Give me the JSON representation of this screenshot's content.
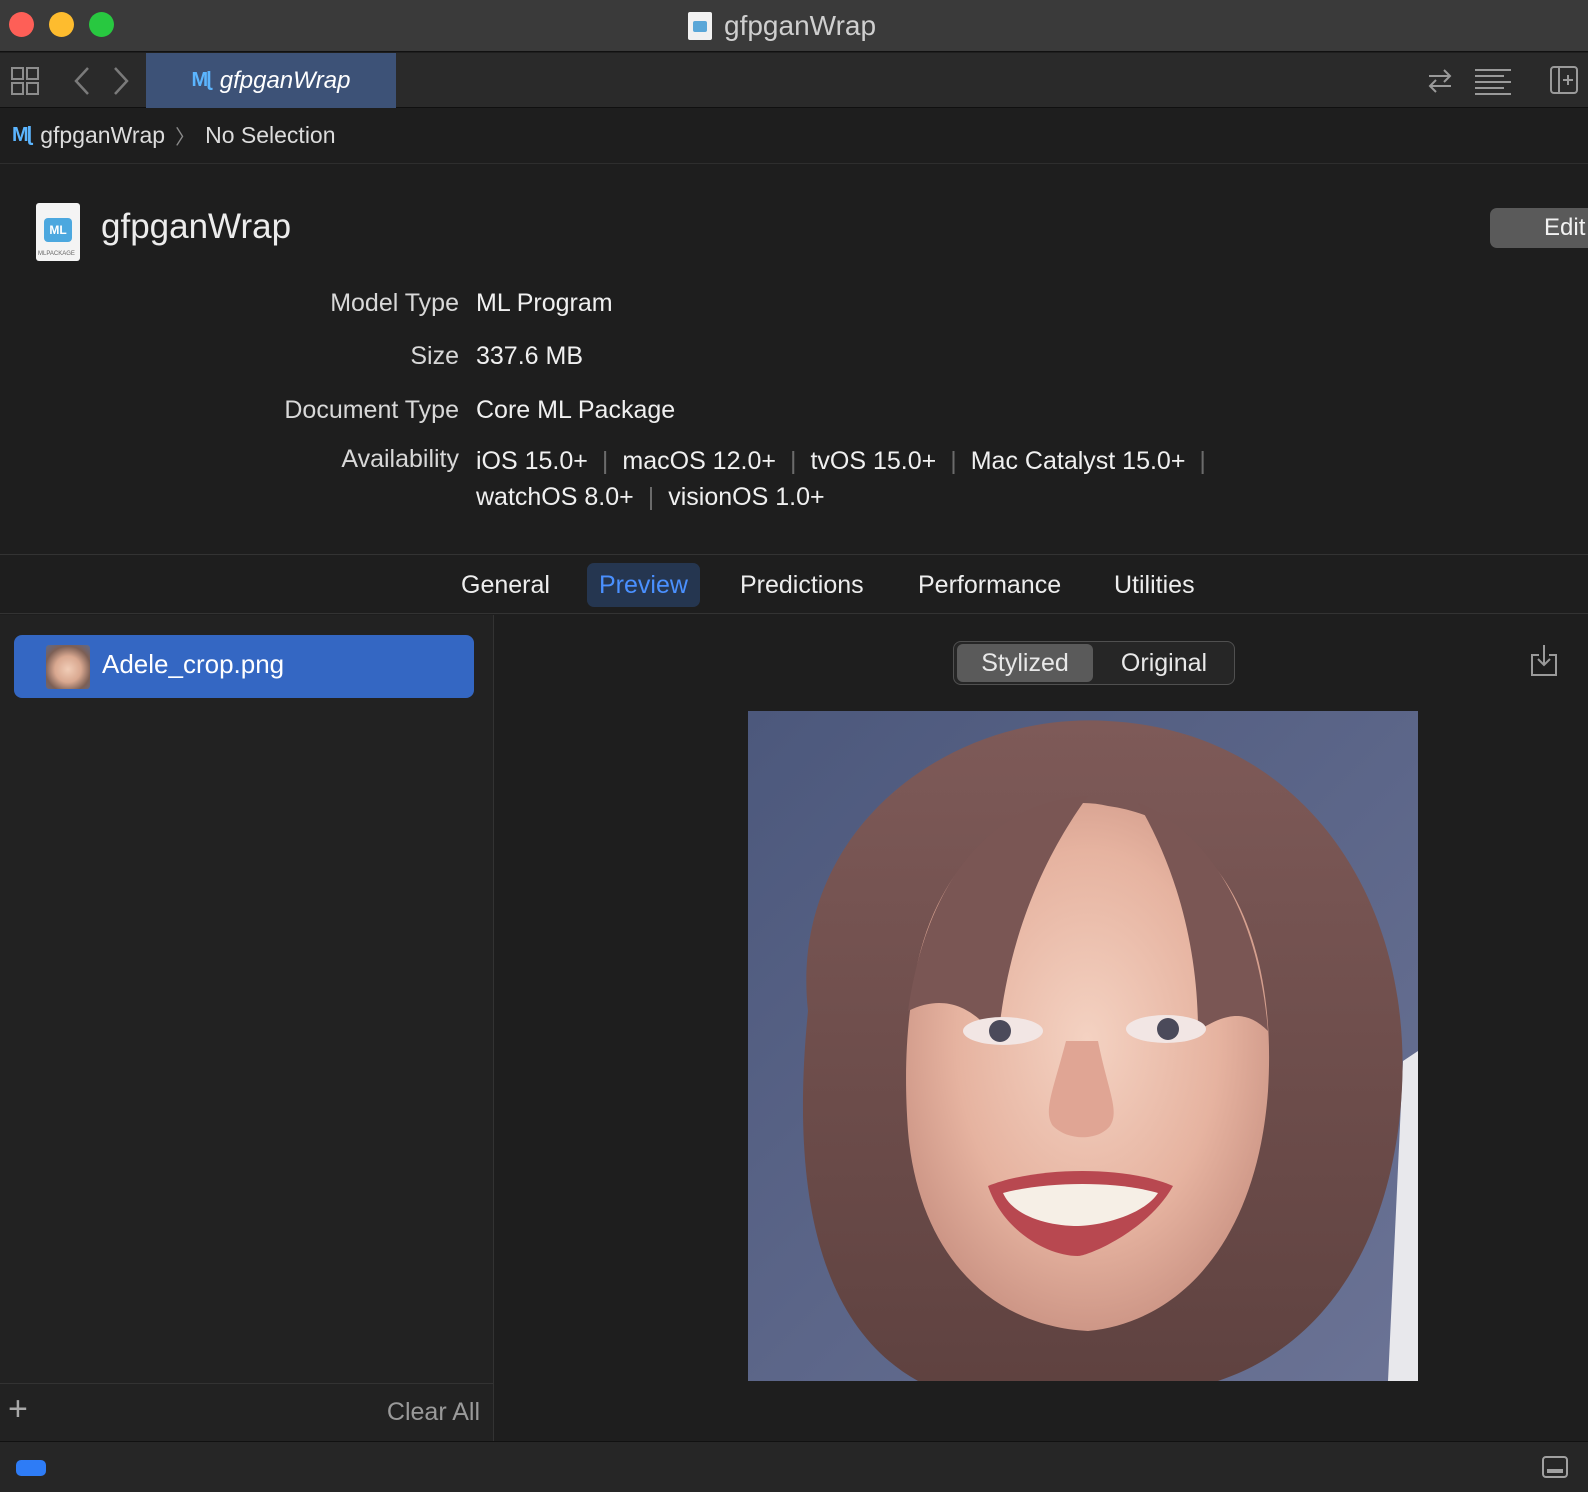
{
  "window": {
    "title": "gfpganWrap"
  },
  "tabbar": {
    "active_tab": "gfpganWrap",
    "ml_glyph": "Mɭ"
  },
  "breadcrumb": {
    "project": "gfpganWrap",
    "separator": "〉",
    "selection": "No Selection"
  },
  "header": {
    "model_name": "gfpganWrap",
    "edit_label": "Edit",
    "package_badge": "MLPACKAGE",
    "properties": [
      {
        "label": "Model Type",
        "value": "ML Program"
      },
      {
        "label": "Size",
        "value": "337.6 MB"
      },
      {
        "label": "Document Type",
        "value": "Core ML Package"
      }
    ],
    "availability": {
      "label": "Availability",
      "line1": [
        "iOS 15.0+",
        "macOS 12.0+",
        "tvOS 15.0+",
        "Mac Catalyst 15.0+"
      ],
      "line2": [
        "watchOS 8.0+",
        "visionOS 1.0+"
      ],
      "separator": "|"
    }
  },
  "tabs": [
    {
      "label": "General"
    },
    {
      "label": "Preview",
      "active": true
    },
    {
      "label": "Predictions"
    },
    {
      "label": "Performance"
    },
    {
      "label": "Utilities"
    }
  ],
  "sidebar": {
    "files": [
      {
        "name": "Adele_crop.png",
        "selected": true
      }
    ],
    "add_label": "+",
    "clear_all_label": "Clear All"
  },
  "preview": {
    "segments": [
      {
        "label": "Stylized",
        "selected": true
      },
      {
        "label": "Original",
        "selected": false
      }
    ]
  },
  "colors": {
    "accent": "#3467c3",
    "tab_active_text": "#4a90ff",
    "traffic_close": "#fe5f57",
    "traffic_min": "#febc2e",
    "traffic_max": "#28c840"
  }
}
